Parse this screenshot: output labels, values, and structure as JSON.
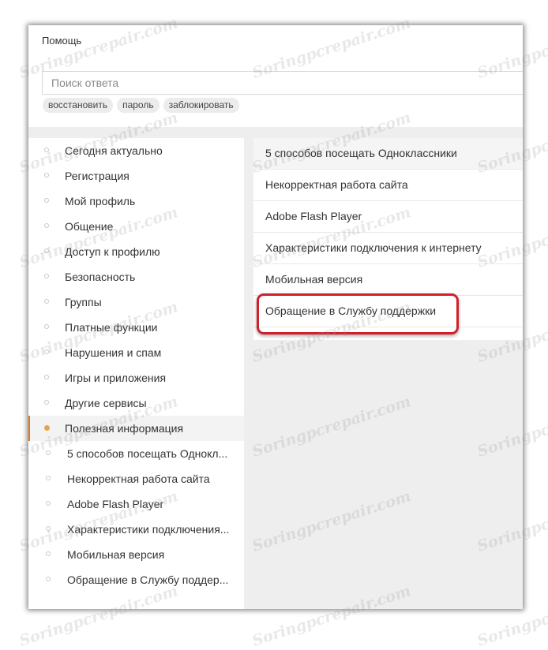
{
  "header": {
    "title": "Помощь"
  },
  "search": {
    "placeholder": "Поиск ответа",
    "value": ""
  },
  "tags": [
    "восстановить",
    "пароль",
    "заблокировать"
  ],
  "sidebar": {
    "items": [
      {
        "label": "Сегодня актуально"
      },
      {
        "label": "Регистрация"
      },
      {
        "label": "Мой профиль"
      },
      {
        "label": "Общение"
      },
      {
        "label": "Доступ к профилю"
      },
      {
        "label": "Безопасность"
      },
      {
        "label": "Группы"
      },
      {
        "label": "Платные функции"
      },
      {
        "label": "Нарушения и спам"
      },
      {
        "label": "Игры и приложения"
      },
      {
        "label": "Другие сервисы"
      },
      {
        "label": "Полезная информация",
        "active": true
      }
    ],
    "subitems": [
      {
        "label": "5 способов посещать Однокл..."
      },
      {
        "label": "Некорректная работа сайта"
      },
      {
        "label": "Adobe Flash Player"
      },
      {
        "label": "Характеристики подключения..."
      },
      {
        "label": "Мобильная версия"
      },
      {
        "label": "Обращение в Службу поддер..."
      }
    ]
  },
  "content": {
    "items": [
      {
        "label": "5 способов посещать Одноклассники"
      },
      {
        "label": "Некорректная работа сайта"
      },
      {
        "label": "Adobe Flash Player"
      },
      {
        "label": "Характеристики подключения к интернету"
      },
      {
        "label": "Мобильная версия"
      },
      {
        "label": "Обращение в Службу поддержки",
        "highlighted": true
      }
    ]
  },
  "annotation": {
    "highlight_color": "#d0202a"
  },
  "accent_color": "#e07b1c",
  "watermark": {
    "text": "Soringpcrepair.com"
  }
}
